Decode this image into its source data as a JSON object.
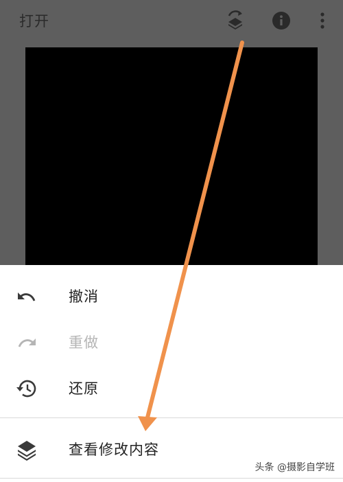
{
  "appbar": {
    "open_label": "打开",
    "icons": [
      "edit-stack-icon",
      "info-icon",
      "more-vert-icon"
    ]
  },
  "menu": {
    "items": [
      {
        "label": "撤消",
        "icon": "undo-icon",
        "enabled": true
      },
      {
        "label": "重做",
        "icon": "redo-icon",
        "enabled": false
      },
      {
        "label": "还原",
        "icon": "history-icon",
        "enabled": true
      },
      {
        "label": "查看修改内容",
        "icon": "layers-icon",
        "enabled": true
      }
    ]
  },
  "watermark": "头条 @摄影自学班",
  "colors": {
    "appbar_bg": "#5e5e5e",
    "photo": "#000000",
    "sheet_bg": "#ffffff",
    "icon_dark": "#2a2a2a",
    "disabled_text": "#b5b5b5",
    "annotation_arrow": "#f0924c"
  }
}
